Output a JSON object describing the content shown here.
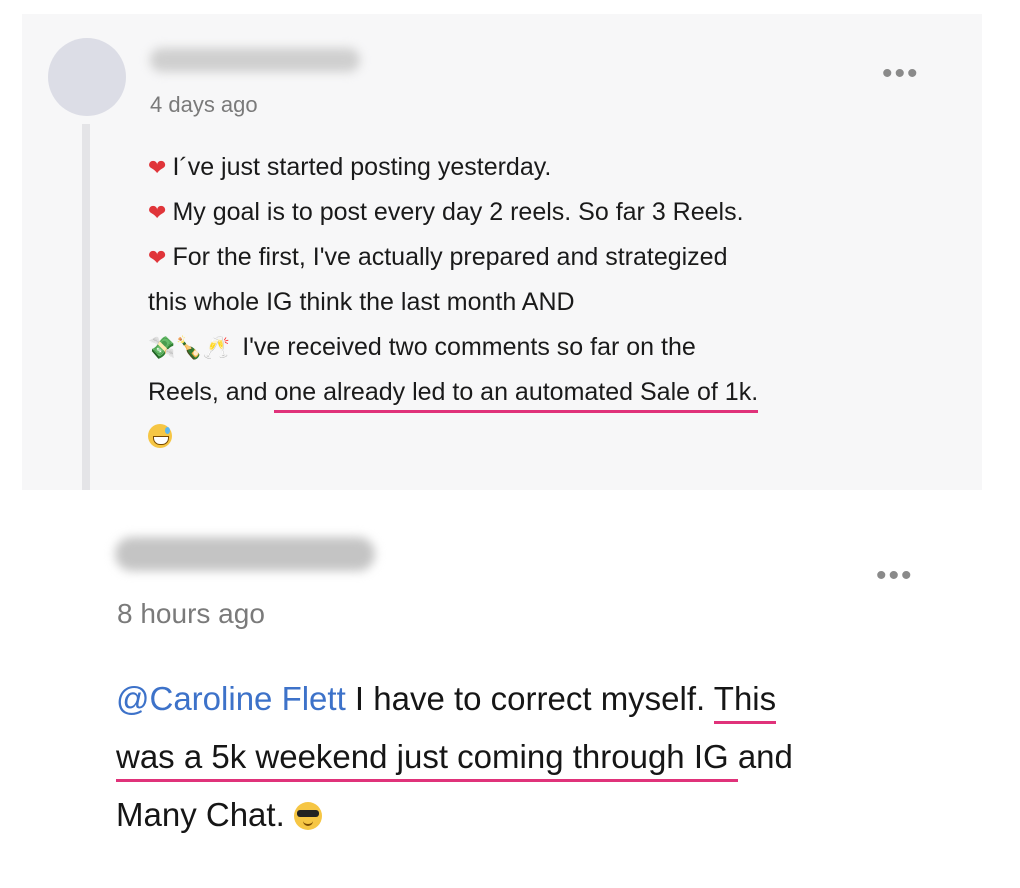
{
  "comments": [
    {
      "time": "4 days ago",
      "more": "•••",
      "lines": [
        {
          "icon": "heart",
          "text": "I´ve just started posting yesterday."
        },
        {
          "icon": "heart",
          "text": "My goal is to post every day 2 reels. So far 3 Reels."
        },
        {
          "icon": "heart",
          "text": "For the first, I've actually prepared and strategized"
        },
        {
          "text": "this whole IG think the last month AND"
        },
        {
          "icons": [
            "money-icon",
            "champagne-icon",
            "toast-icon"
          ],
          "text": "I've received two comments so far on the"
        },
        {
          "text_before": "Reels, and ",
          "text_underlined": "one already led to an automated Sale of 1k."
        }
      ],
      "end_icon": "sweat-smile-icon"
    },
    {
      "time": "8 hours ago",
      "more": "•••",
      "mention": "@Caroline Flett",
      "line1_a": " I have to correct myself. ",
      "line1_u": "This",
      "line2_u": "was a 5k weekend just coming through IG ",
      "line2_b": "and",
      "line3": "Many Chat.",
      "end_icon": "sunglasses-icon"
    }
  ],
  "colors": {
    "heart": "#e0353a",
    "underline": "#e0327a",
    "mention": "#3d72c9"
  }
}
